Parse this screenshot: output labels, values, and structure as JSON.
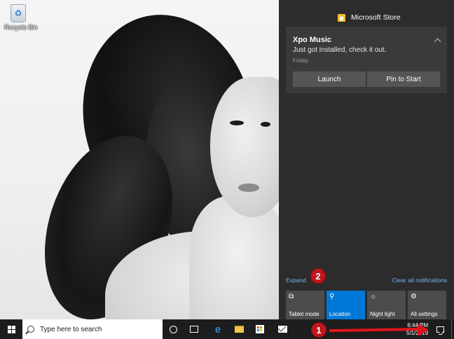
{
  "desktop": {
    "recycle_bin_label": "Recycle Bin"
  },
  "action_center": {
    "app_header": "Microsoft Store",
    "notification": {
      "title": "Xpo Music",
      "body": "Just got installed, check it out.",
      "time": "Friday",
      "buttons": [
        "Launch",
        "Pin to Start"
      ]
    },
    "expand_label": "Expand",
    "clear_all_label": "Clear all notifications",
    "quick_actions": [
      {
        "label": "Tablet mode",
        "icon": "tablet-mode-icon",
        "active": false
      },
      {
        "label": "Location",
        "icon": "location-icon",
        "active": true
      },
      {
        "label": "Night light",
        "icon": "night-light-icon",
        "active": false
      },
      {
        "label": "All settings",
        "icon": "gear-icon",
        "active": false
      }
    ],
    "accent_color": "#0078d7"
  },
  "taskbar": {
    "search_placeholder": "Type here to search",
    "clock_time": "6:44 PM",
    "clock_date": "5/1/2019"
  },
  "annotations": {
    "step1": "1",
    "step2": "2",
    "color": "#e0151c"
  }
}
